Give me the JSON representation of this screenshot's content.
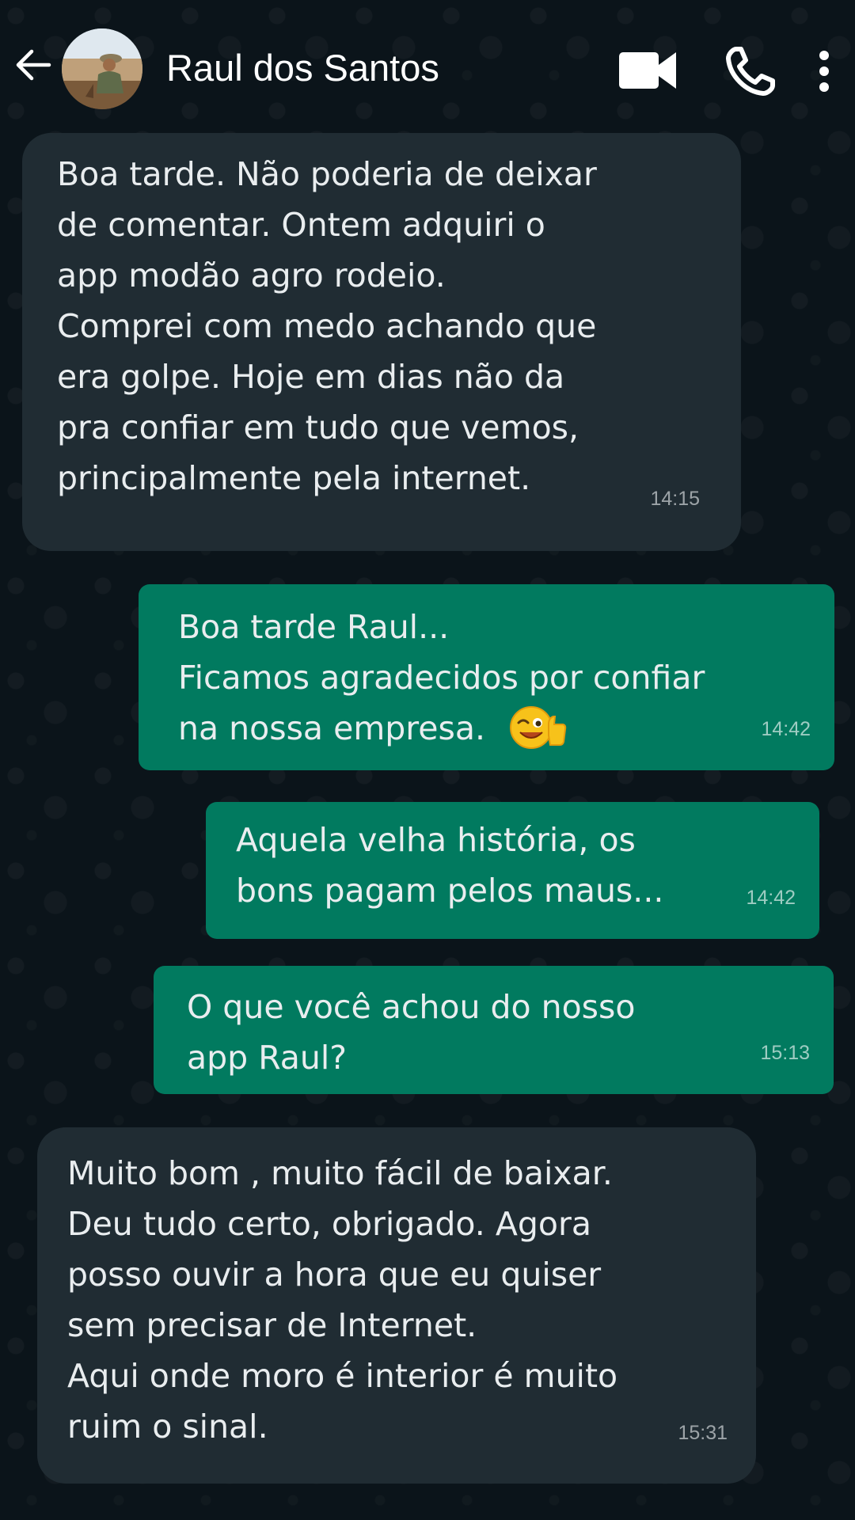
{
  "header": {
    "contact_name": "Raul dos Santos",
    "back_icon": "arrow-left-icon",
    "video_icon": "video-camera-icon",
    "call_icon": "phone-icon",
    "menu_icon": "more-vertical-icon"
  },
  "messages": [
    {
      "direction": "incoming",
      "text": "Boa tarde. Não poderia de deixar\nde comentar. Ontem adquiri o\napp modão agro rodeio.\nComprei com medo achando que\nera golpe. Hoje em dias não da\npra confiar em tudo que vemos,\nprincipalmente pela internet.",
      "time": "14:15"
    },
    {
      "direction": "outgoing",
      "text": "Boa tarde Raul...\nFicamos agradecidos por confiar\nna nossa empresa.",
      "emoji": "winking-thumbs-up-emoji",
      "time": "14:42"
    },
    {
      "direction": "outgoing",
      "text": "Aquela velha história, os\nbons pagam pelos maus...",
      "time": "14:42"
    },
    {
      "direction": "outgoing",
      "text": "O que você achou do nosso\napp Raul?",
      "time": "15:13"
    },
    {
      "direction": "incoming",
      "text": "Muito bom , muito fácil de baixar.\nDeu tudo certo, obrigado. Agora\nposso ouvir a hora que eu quiser\nsem precisar de Internet.\nAqui onde moro é interior é muito\nruim o sinal.",
      "time": "15:31"
    }
  ],
  "colors": {
    "background": "#0b141a",
    "incoming_bubble": "#202c33",
    "outgoing_bubble": "#017a5f",
    "text": "#e9edef"
  }
}
